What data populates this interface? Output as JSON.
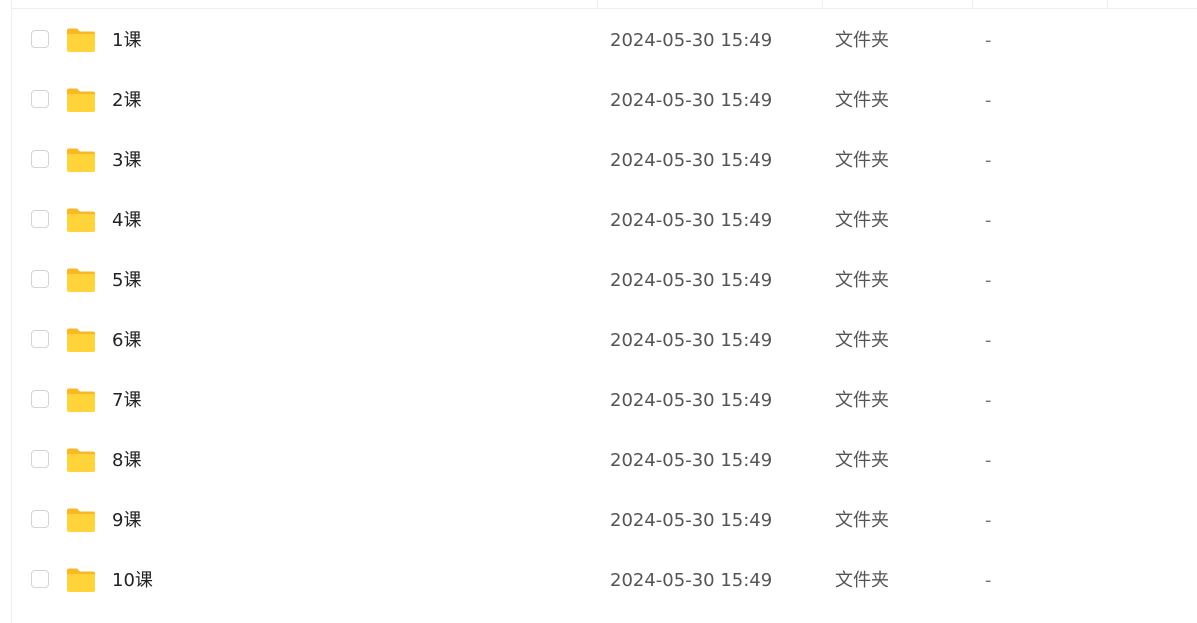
{
  "files": [
    {
      "name": "1课",
      "modified": "2024-05-30 15:49",
      "type": "文件夹",
      "size": "-"
    },
    {
      "name": "2课",
      "modified": "2024-05-30 15:49",
      "type": "文件夹",
      "size": "-"
    },
    {
      "name": "3课",
      "modified": "2024-05-30 15:49",
      "type": "文件夹",
      "size": "-"
    },
    {
      "name": "4课",
      "modified": "2024-05-30 15:49",
      "type": "文件夹",
      "size": "-"
    },
    {
      "name": "5课",
      "modified": "2024-05-30 15:49",
      "type": "文件夹",
      "size": "-"
    },
    {
      "name": "6课",
      "modified": "2024-05-30 15:49",
      "type": "文件夹",
      "size": "-"
    },
    {
      "name": "7课",
      "modified": "2024-05-30 15:49",
      "type": "文件夹",
      "size": "-"
    },
    {
      "name": "8课",
      "modified": "2024-05-30 15:49",
      "type": "文件夹",
      "size": "-"
    },
    {
      "name": "9课",
      "modified": "2024-05-30 15:49",
      "type": "文件夹",
      "size": "-"
    },
    {
      "name": "10课",
      "modified": "2024-05-30 15:49",
      "type": "文件夹",
      "size": "-"
    }
  ],
  "icons": {
    "folder": "folder-icon",
    "checkbox": "checkbox"
  },
  "colors": {
    "folder_body": "#FFD43A",
    "folder_tab": "#F9B824",
    "checkbox_border": "#D4D4D4",
    "divider": "#EEEEEE"
  }
}
